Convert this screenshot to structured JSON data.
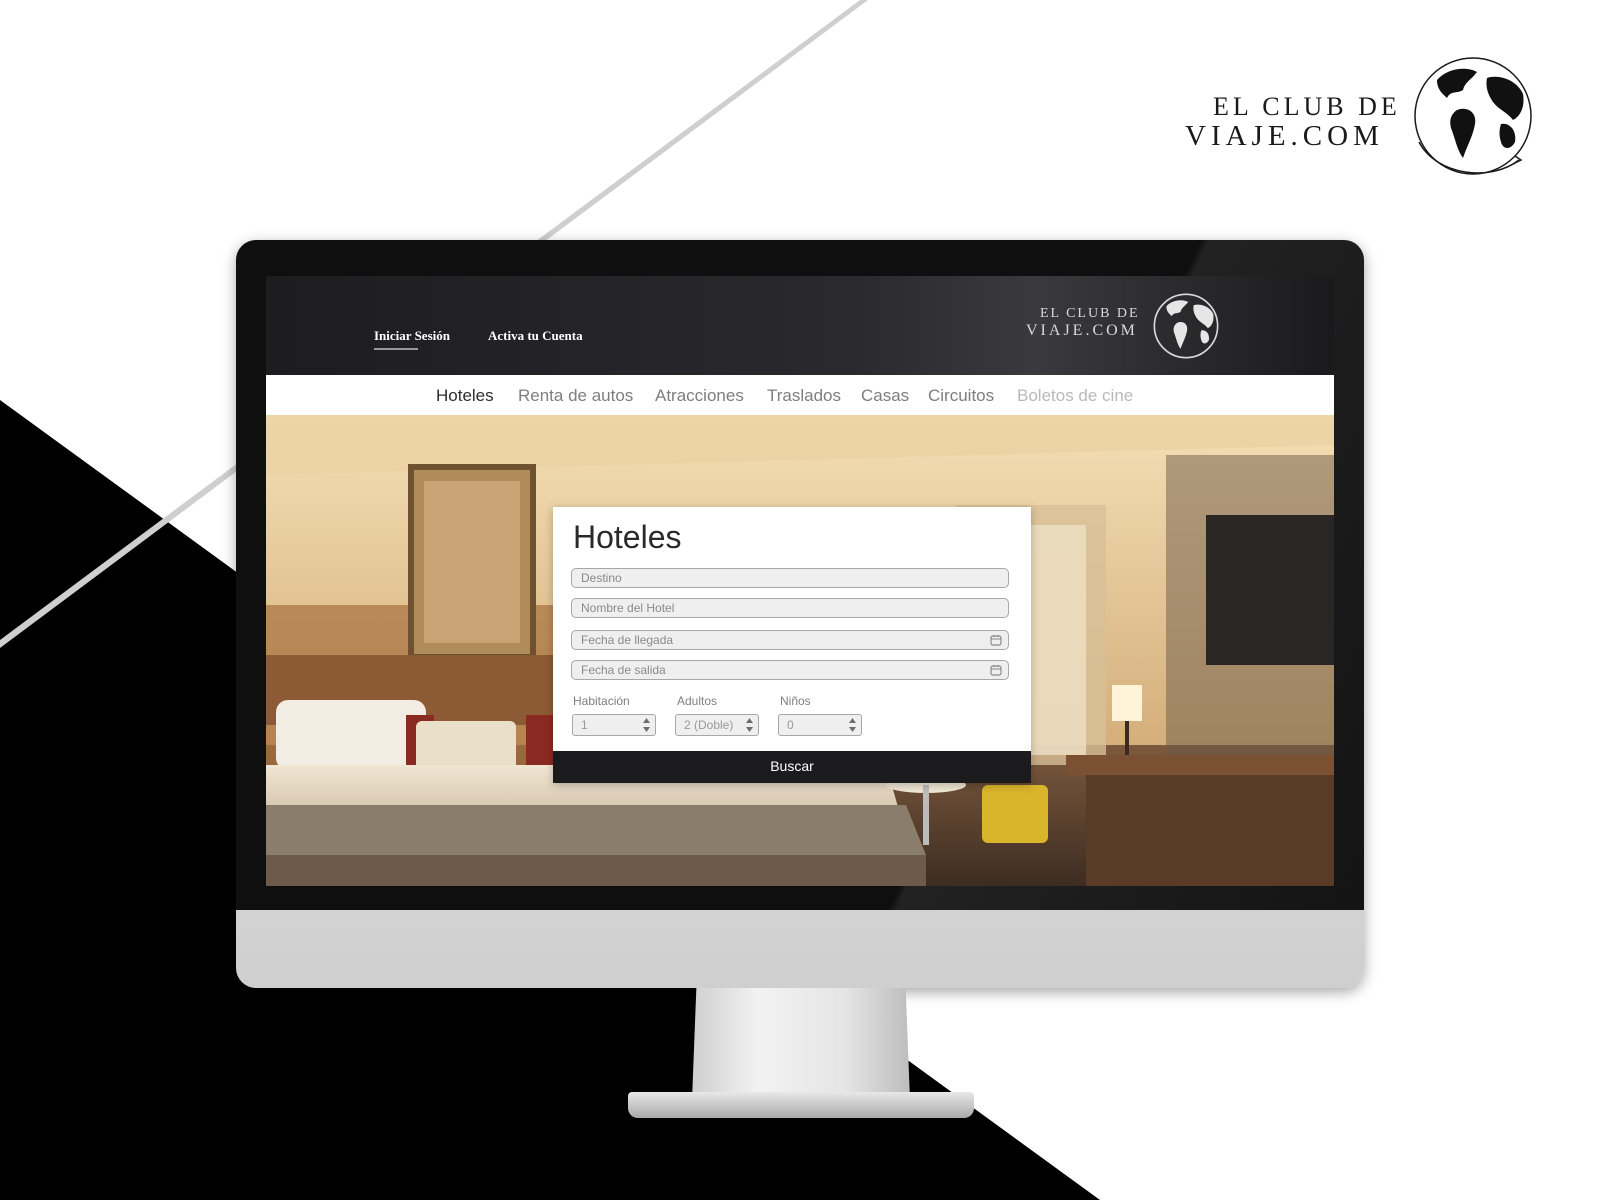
{
  "brand": {
    "line1": "EL CLUB DE",
    "line2": "VIAJE.COM"
  },
  "header": {
    "login_label": "Iniciar Sesión",
    "activate_label": "Activa tu Cuenta"
  },
  "nav": {
    "items": [
      {
        "label": "Hoteles"
      },
      {
        "label": "Renta de autos"
      },
      {
        "label": "Atracciones"
      },
      {
        "label": "Traslados"
      },
      {
        "label": "Casas"
      },
      {
        "label": "Circuitos"
      },
      {
        "label": "Boletos de cine"
      }
    ],
    "active_index": 0
  },
  "search": {
    "title": "Hoteles",
    "destination_placeholder": "Destino",
    "hotel_name_placeholder": "Nombre del Hotel",
    "checkin_placeholder": "Fecha de llegada",
    "checkout_placeholder": "Fecha de salida",
    "rooms_label": "Habitación",
    "rooms_value": "1",
    "adults_label": "Adultos",
    "adults_value": "2 (Doble)",
    "children_label": "Niños",
    "children_value": "0",
    "submit_label": "Buscar"
  },
  "icons": {
    "calendar": "calendar-icon",
    "stepper": "up-down-arrows-icon",
    "globe": "globe-icon"
  },
  "colors": {
    "header_bg": "#1d1c1f",
    "button_bg": "#1b1a1d",
    "nav_active": "#2e2e2e",
    "nav_inactive": "#7e7e7e"
  }
}
